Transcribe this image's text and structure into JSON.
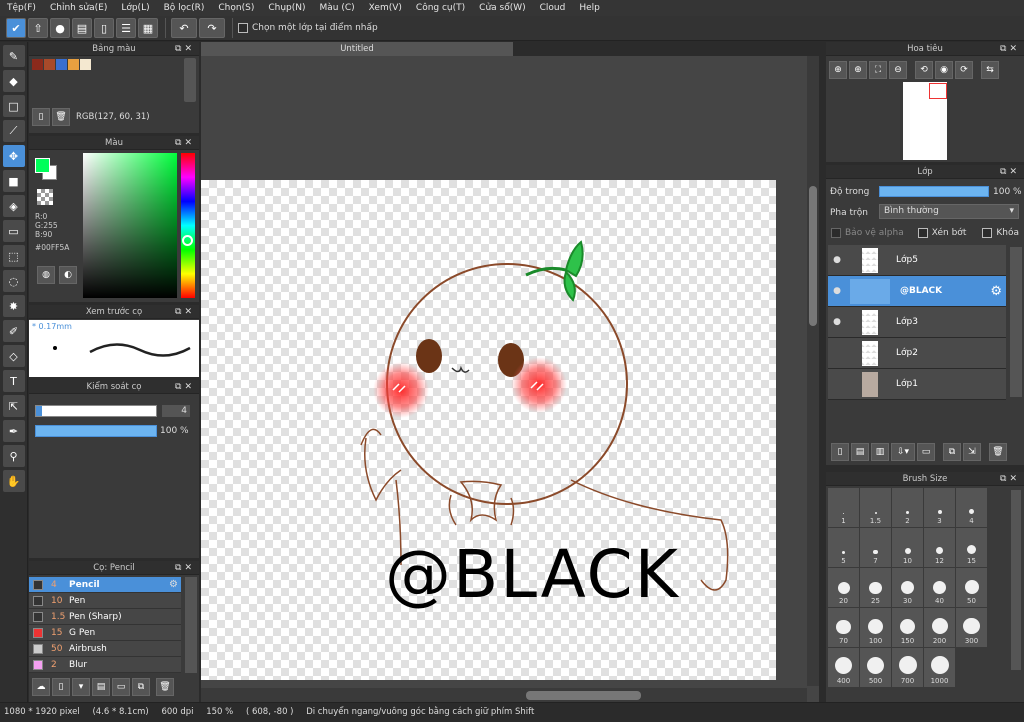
{
  "menu": [
    "Tệp(F)",
    "Chỉnh sửa(E)",
    "Lớp(L)",
    "Bộ lọc(R)",
    "Chọn(S)",
    "Chụp(N)",
    "Màu (C)",
    "Xem(V)",
    "Công cụ(T)",
    "Cửa sổ(W)",
    "Cloud",
    "Help"
  ],
  "toolbar": {
    "snap_label": "Chọn một lớp tại điểm nhấp"
  },
  "panels": {
    "palette": {
      "title": "Bảng màu",
      "rgb": "RGB(127, 60, 31)",
      "swatches": [
        "#8b2a1c",
        "#a84a2a",
        "#3a6fd0",
        "#e8a040",
        "#f4e8d0"
      ]
    },
    "color": {
      "title": "Màu",
      "r": "R:0",
      "g": "G:255",
      "b": "B:90",
      "hex": "#00FF5A"
    },
    "brush_preview": {
      "title": "Xem trước cọ",
      "size": "* 0.17mm"
    },
    "brush_control": {
      "title": "Kiểm soát cọ",
      "size_value": "4",
      "opacity_value": "100 %"
    },
    "brush_list": {
      "title": "Cọ: Pencil",
      "items": [
        {
          "size": "4",
          "name": "Pencil",
          "color": "#333333"
        },
        {
          "size": "10",
          "name": "Pen",
          "color": "#333333"
        },
        {
          "size": "1.5",
          "name": "Pen (Sharp)",
          "color": "#333333"
        },
        {
          "size": "15",
          "name": "G Pen",
          "color": "#ee3333"
        },
        {
          "size": "50",
          "name": "Airbrush",
          "color": "#cccccc"
        },
        {
          "size": "2",
          "name": "Blur",
          "color": "#f4a0f0"
        }
      ]
    },
    "navigator": {
      "title": "Hoa tiêu"
    },
    "layers": {
      "title": "Lớp",
      "opacity_label": "Độ trong",
      "opacity_value": "100 %",
      "blend_label": "Pha trộn",
      "blend_value": "Bình thường",
      "alpha_label": "Bảo vệ alpha",
      "clip_label": "Xén bớt",
      "lock_label": "Khóa",
      "items": [
        {
          "name": "Lớp5",
          "visible": true,
          "selected": false
        },
        {
          "name": "@BLACK",
          "visible": true,
          "selected": true
        },
        {
          "name": "Lớp3",
          "visible": true,
          "selected": false
        },
        {
          "name": "Lớp2",
          "visible": false,
          "selected": false
        },
        {
          "name": "Lớp1",
          "visible": false,
          "selected": false
        }
      ]
    },
    "brush_size": {
      "title": "Brush Size",
      "sizes": [
        "1",
        "1.5",
        "2",
        "3",
        "4",
        "5",
        "7",
        "10",
        "12",
        "15",
        "20",
        "25",
        "30",
        "40",
        "50",
        "70",
        "100",
        "150",
        "200",
        "300",
        "400",
        "500",
        "700",
        "1000"
      ]
    }
  },
  "canvas": {
    "tab": "Untitled",
    "text": "@BLACK"
  },
  "status": {
    "size": "1080 * 1920 pixel",
    "cm": "(4.6 * 8.1cm)",
    "dpi": "600 dpi",
    "zoom": "150 %",
    "coords": "( 608, -80 )",
    "hint": "Di chuyển ngang/vuông góc bằng cách giữ phím Shift"
  }
}
